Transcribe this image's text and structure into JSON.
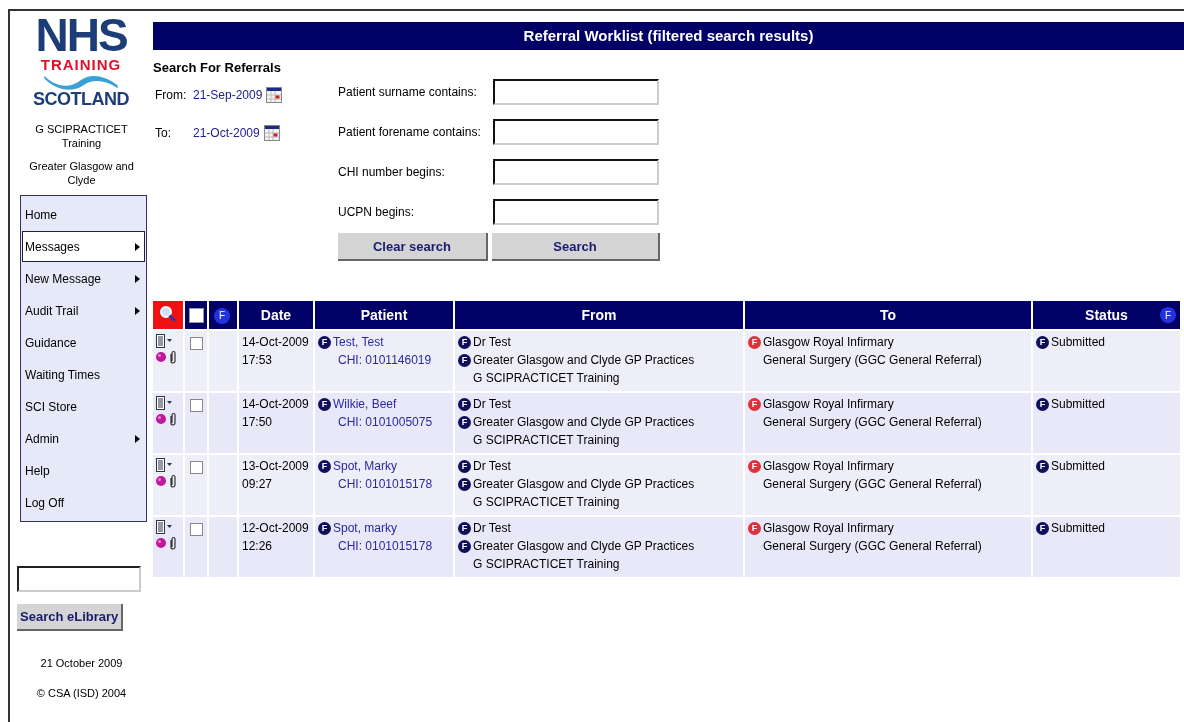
{
  "logo": {
    "top": "NHS",
    "stamp": "TRAINING",
    "bottom": "SCOTLAND"
  },
  "sidebar": {
    "org": "G SCIPRACTICET Training",
    "region": "Greater Glasgow and Clyde",
    "menu": [
      {
        "label": "Home",
        "selected": false,
        "submenu": false
      },
      {
        "label": "Messages",
        "selected": true,
        "submenu": true
      },
      {
        "label": "New Message",
        "selected": false,
        "submenu": true
      },
      {
        "label": "Audit Trail",
        "selected": false,
        "submenu": true
      },
      {
        "label": "Guidance",
        "selected": false,
        "submenu": false
      },
      {
        "label": "Waiting Times",
        "selected": false,
        "submenu": false
      },
      {
        "label": "SCI Store",
        "selected": false,
        "submenu": false
      },
      {
        "label": "Admin",
        "selected": false,
        "submenu": true
      },
      {
        "label": "Help",
        "selected": false,
        "submenu": false
      },
      {
        "label": "Log Off",
        "selected": false,
        "submenu": false
      }
    ],
    "search_button": "Search eLibrary",
    "date": "21 October 2009",
    "copyright": "© CSA (ISD) 2004"
  },
  "header": {
    "title": "Referral Worklist (filtered search results)"
  },
  "search": {
    "title": "Search For Referrals",
    "dates": [
      {
        "label": "From:",
        "value": "21-Sep-2009"
      },
      {
        "label": "To:",
        "value": "21-Oct-2009"
      }
    ],
    "fields": [
      {
        "label": "Patient surname contains:"
      },
      {
        "label": "Patient forename contains:"
      },
      {
        "label": "CHI number begins:"
      },
      {
        "label": "UCPN begins:"
      }
    ],
    "buttons": [
      "Clear search",
      "Search"
    ]
  },
  "table": {
    "select_all_checked": false,
    "flag_header": "F",
    "status_flag": "F",
    "columns": [
      "Date",
      "Patient",
      "From",
      "To",
      "Status"
    ],
    "rows": [
      {
        "checked": false,
        "date": "14-Oct-2009",
        "time": "17:53",
        "patient": {
          "flag": {
            "text": "F",
            "color": "#10105a"
          },
          "name": "Test, Test",
          "chi": "CHI: 0101146019"
        },
        "from": [
          {
            "flag": {
              "text": "F",
              "color": "#10105a"
            },
            "text": "Dr Test"
          },
          {
            "flag": {
              "text": "F",
              "color": "#10105a"
            },
            "text": "Greater Glasgow and Clyde GP Practices"
          },
          {
            "text": "G SCIPRACTICET Training"
          }
        ],
        "to": [
          {
            "flag": {
              "text": "F",
              "color": "#e0303c"
            },
            "text": "Glasgow Royal Infirmary"
          },
          {
            "text": "General Surgery (GGC General Referral)"
          }
        ],
        "status": {
          "flag": {
            "text": "F",
            "color": "#10105a"
          },
          "text": "Submitted"
        }
      },
      {
        "checked": false,
        "date": "14-Oct-2009",
        "time": "17:50",
        "patient": {
          "flag": {
            "text": "F",
            "color": "#10105a"
          },
          "name": "Wilkie, Beef",
          "chi": "CHI: 0101005075"
        },
        "from": [
          {
            "flag": {
              "text": "F",
              "color": "#10105a"
            },
            "text": "Dr Test"
          },
          {
            "flag": {
              "text": "F",
              "color": "#10105a"
            },
            "text": "Greater Glasgow and Clyde GP Practices"
          },
          {
            "text": "G SCIPRACTICET Training"
          }
        ],
        "to": [
          {
            "flag": {
              "text": "F",
              "color": "#e0303c"
            },
            "text": "Glasgow Royal Infirmary"
          },
          {
            "text": "General Surgery (GGC General Referral)"
          }
        ],
        "status": {
          "flag": {
            "text": "F",
            "color": "#10105a"
          },
          "text": "Submitted"
        }
      },
      {
        "checked": false,
        "date": "13-Oct-2009",
        "time": "09:27",
        "patient": {
          "flag": {
            "text": "F",
            "color": "#10105a"
          },
          "name": "Spot, Marky",
          "chi": "CHI: 0101015178"
        },
        "from": [
          {
            "flag": {
              "text": "F",
              "color": "#10105a"
            },
            "text": "Dr Test"
          },
          {
            "flag": {
              "text": "F",
              "color": "#10105a"
            },
            "text": "Greater Glasgow and Clyde GP Practices"
          },
          {
            "text": "G SCIPRACTICET Training"
          }
        ],
        "to": [
          {
            "flag": {
              "text": "F",
              "color": "#e0303c"
            },
            "text": "Glasgow Royal Infirmary"
          },
          {
            "text": "General Surgery (GGC General Referral)"
          }
        ],
        "status": {
          "flag": {
            "text": "F",
            "color": "#10105a"
          },
          "text": "Submitted"
        }
      },
      {
        "checked": false,
        "date": "12-Oct-2009",
        "time": "12:26",
        "patient": {
          "flag": {
            "text": "F",
            "color": "#10105a"
          },
          "name": "Spot, marky",
          "chi": "CHI: 0101015178"
        },
        "from": [
          {
            "flag": {
              "text": "F",
              "color": "#10105a"
            },
            "text": "Dr Test"
          },
          {
            "flag": {
              "text": "F",
              "color": "#10105a"
            },
            "text": "Greater Glasgow and Clyde GP Practices"
          },
          {
            "text": "G SCIPRACTICET Training"
          }
        ],
        "to": [
          {
            "flag": {
              "text": "F",
              "color": "#e0303c"
            },
            "text": "Glasgow Royal Infirmary"
          },
          {
            "text": "General Surgery (GGC General Referral)"
          }
        ],
        "status": {
          "flag": {
            "text": "F",
            "color": "#10105a"
          },
          "text": "Submitted"
        }
      }
    ]
  }
}
